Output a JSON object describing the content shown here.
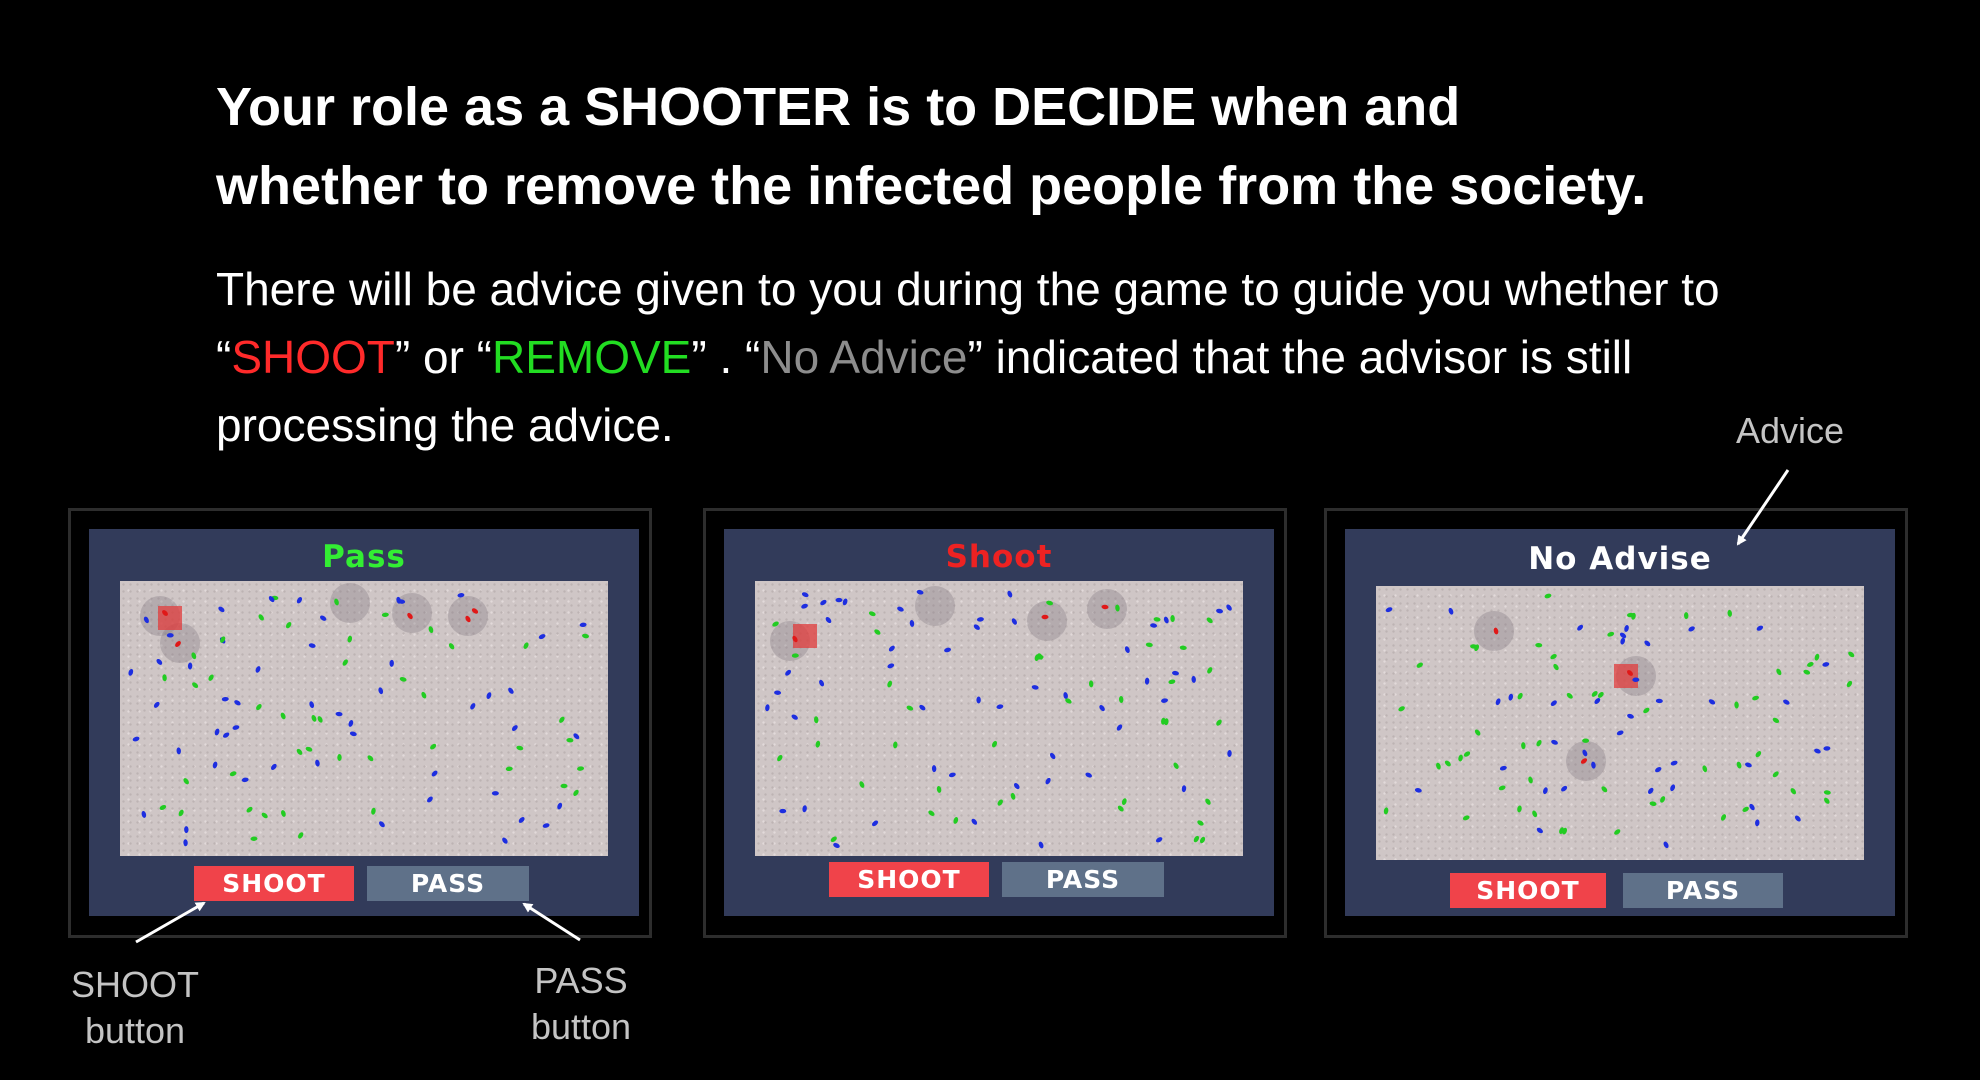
{
  "heading": {
    "line1": "Your role as a SHOOTER is to DECIDE when and",
    "line2": "whether to remove the infected people from the society."
  },
  "instructions": {
    "part1": "There will be advice given to you during the game to guide you whether to “",
    "shoot_word": "SHOOT",
    "part2": "” or “",
    "remove_word": "REMOVE",
    "part3": "” . “",
    "no_advice_word": "No Advice",
    "part4": "” indicated that the advisor is still processing the advice."
  },
  "colors": {
    "shoot_red": "#ff2a2a",
    "remove_green": "#22dd22",
    "no_advice_gray": "#8d8d8d",
    "advice_pass_green": "#33ee33",
    "advice_shoot_red": "#ee2222",
    "advice_none_white": "#ffffff",
    "shoot_button": "#f0434a",
    "pass_button": "#5f7189"
  },
  "panels": [
    {
      "advice": "Pass",
      "advice_color": "#33ee33",
      "shoot_label": "SHOOT",
      "pass_label": "PASS"
    },
    {
      "advice": "Shoot",
      "advice_color": "#ee2222",
      "shoot_label": "SHOOT",
      "pass_label": "PASS"
    },
    {
      "advice": "No Advise",
      "advice_color": "#ffffff",
      "shoot_label": "SHOOT",
      "pass_label": "PASS"
    }
  ],
  "callouts": {
    "advice": "Advice",
    "shoot_button_line1": "SHOOT",
    "shoot_button_line2": "button",
    "pass_button_line1": "PASS",
    "pass_button_line2": "button"
  }
}
